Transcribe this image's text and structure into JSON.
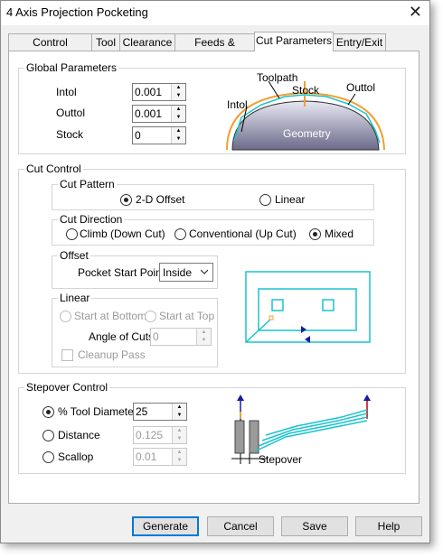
{
  "window": {
    "title": "4 Axis Projection Pocketing",
    "close_glyph": "✕"
  },
  "tabs": [
    "Control Geometry",
    "Tool",
    "Clearance",
    "Feeds & Speeds",
    "Cut Parameters",
    "Entry/Exit"
  ],
  "active_tab": "Cut Parameters",
  "global_parameters": {
    "title": "Global Parameters",
    "intol_label": "Intol",
    "intol_value": "0.001",
    "outtol_label": "Outtol",
    "outtol_value": "0.001",
    "stock_label": "Stock",
    "stock_value": "0",
    "diagram": {
      "toolpath": "Toolpath",
      "stock": "Stock",
      "intol": "Intol",
      "outtol": "Outtol",
      "geometry": "Geometry"
    }
  },
  "cut_control": {
    "title": "Cut Control",
    "cut_pattern": {
      "title": "Cut Pattern",
      "offset_2d": "2-D Offset",
      "linear": "Linear",
      "selected": "2-D Offset"
    },
    "cut_direction": {
      "title": "Cut Direction",
      "climb": "Climb (Down Cut)",
      "conventional": "Conventional (Up Cut)",
      "mixed": "Mixed",
      "selected": "Mixed"
    },
    "offset": {
      "title": "Offset",
      "pocket_start_label": "Pocket Start Point",
      "pocket_start_value": "Inside"
    },
    "linear": {
      "title": "Linear",
      "start_bottom": "Start at Bottom",
      "start_top": "Start at Top",
      "angle_label": "Angle of Cuts",
      "angle_value": "0",
      "cleanup_label": "Cleanup Pass"
    }
  },
  "stepover_control": {
    "title": "Stepover Control",
    "tool_diameter_label": "% Tool Diameter",
    "tool_diameter_value": "25",
    "distance_label": "Distance",
    "distance_value": "0.125",
    "scallop_label": "Scallop",
    "scallop_value": "0.01",
    "selected": "% Tool Diameter",
    "diagram_label": "Stepover"
  },
  "buttons": {
    "generate": "Generate",
    "cancel": "Cancel",
    "save": "Save",
    "help": "Help"
  },
  "colors": {
    "accent": "#0078d7",
    "toolpath_cyan": "#19c3cf",
    "stock_orange": "#f0a030",
    "arrow_blue": "#1a1aa8"
  }
}
